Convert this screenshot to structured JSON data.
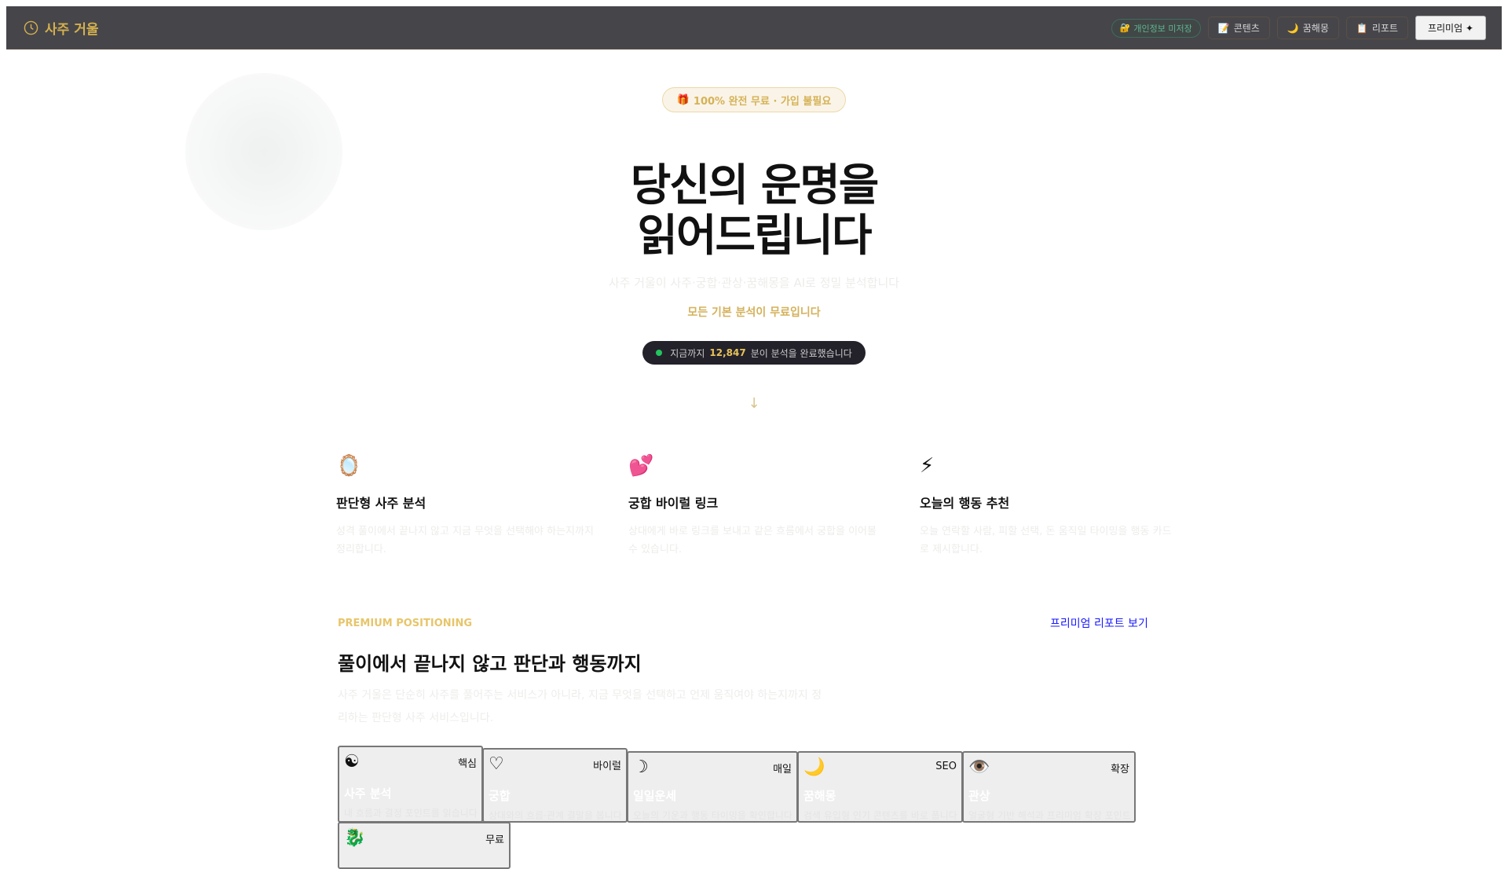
{
  "header": {
    "brand": "사주 거울",
    "privacy": "개인정보 미저장",
    "nav": [
      "콘텐츠",
      "꿈해몽",
      "리포트"
    ],
    "premium": "프리미엄 ✦"
  },
  "hero": {
    "badge": "100% 완전 무료 · 가입 불필요",
    "title_line1": "당신의 운명을",
    "title_line2": "읽어드립니다",
    "subtitle": "사주 거울이 사주·궁합·관상·꿈해몽을 AI로 정밀 분석합니다",
    "free_note": "모든 기본 분석이 무료입니다",
    "counter_prefix": "지금까지 ",
    "counter_value": "12,847",
    "counter_suffix": "분이 분석을 완료했습니다"
  },
  "features": [
    {
      "icon": "🪞",
      "title": "판단형 사주 분석",
      "desc": "성격 풀이에서 끝나지 않고 지금 무엇을 선택해야 하는지까지 정리합니다."
    },
    {
      "icon": "💕",
      "title": "궁합 바이럴 링크",
      "desc": "상대에게 바로 링크를 보내고 같은 흐름에서 궁합을 이어볼 수 있습니다."
    },
    {
      "icon": "⚡",
      "title": "오늘의 행동 추천",
      "desc": "오늘 연락할 사람, 피할 선택, 돈 움직일 타이밍을 행동 카드로 제시합니다."
    }
  ],
  "premium": {
    "eyebrow": "PREMIUM POSITIONING",
    "link": "프리미엄 리포트 보기",
    "heading": "풀이에서 끝나지 않고 판단과 행동까지",
    "desc": "사주 거울은 단순히 사주를 풀어주는 서비스가 아니라, 지금 무엇을 선택하고 언제 움직여야 하는지까지 정리하는 판단형 사주 서비스입니다."
  },
  "services": [
    {
      "icon": "☯",
      "tag": "핵심",
      "title": "사주 분석",
      "desc": "내 흐름과 결정 포인트를 읽습니다"
    },
    {
      "icon": "♡",
      "tag": "바이럴",
      "title": "궁합",
      "desc": "상대와의 흐름·관계 결말을 봅니다"
    },
    {
      "icon": "☽",
      "tag": "매일",
      "title": "일일운세",
      "desc": "오늘의 기운과 행동 타이밍을 확인합니다"
    },
    {
      "icon": "🌙",
      "tag": "SEO",
      "title": "꿈해몽",
      "desc": "검색 유입형 인기 콘텐츠를 바로 풉니다"
    },
    {
      "icon": "👁️",
      "tag": "확장",
      "title": "관상",
      "desc": "얼굴형 기반 해석과 프리미엄 확장 포인트"
    },
    {
      "icon": "🐉",
      "tag": "무료",
      "title": "",
      "desc": ""
    }
  ]
}
